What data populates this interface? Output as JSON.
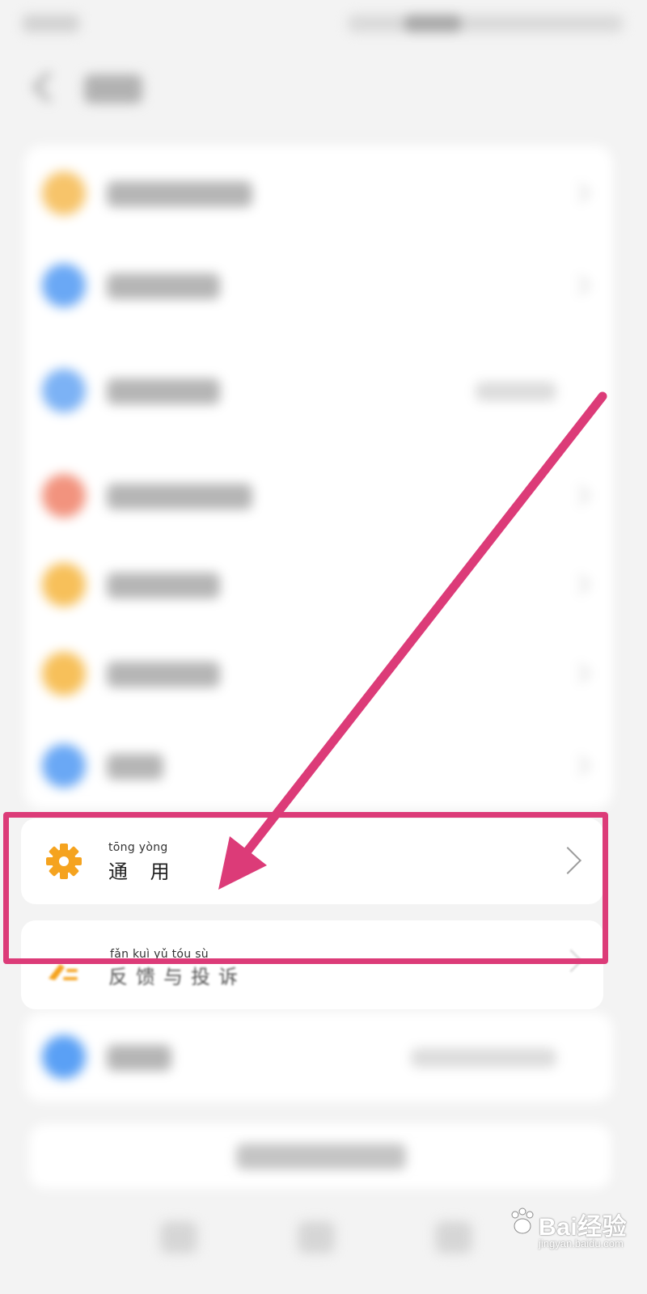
{
  "settings_list": {
    "general": {
      "pinyin": "tōng yòng",
      "label": "通 用"
    },
    "feedback": {
      "pinyin": "fǎn  kuì   yǔ   tóu   sù",
      "label": "反馈与投诉"
    }
  },
  "watermark": {
    "brand": "Bai经验",
    "url": "jingyan.baidu.com"
  },
  "colors": {
    "highlight": "#dc3b78",
    "gear_icon": "#f5a31f",
    "blue_icon": "#5aa0f5",
    "orange_icon": "#f7b84a",
    "red_icon": "#f28c7a"
  },
  "icons": {
    "general": "gear-icon",
    "feedback": "feedback-icon",
    "chevron": "chevron-right-icon",
    "back": "back-arrow-icon"
  }
}
